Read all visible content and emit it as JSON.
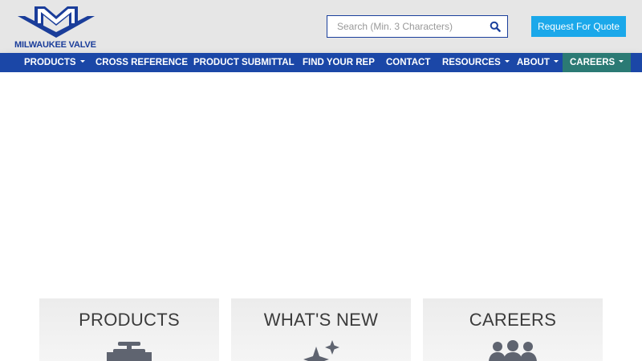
{
  "header": {
    "logo_text": "MILWAUKEE VALVE",
    "search": {
      "placeholder": "Search (Min. 3 Characters)",
      "value": ""
    },
    "quote_button": "Request For Quote"
  },
  "nav": {
    "items": [
      {
        "label": "PRODUCTS",
        "dropdown": true
      },
      {
        "label": "CROSS REFERENCE",
        "dropdown": false
      },
      {
        "label": "PRODUCT SUBMITTAL",
        "dropdown": false
      },
      {
        "label": "FIND YOUR REP",
        "dropdown": false
      },
      {
        "label": "CONTACT",
        "dropdown": false
      },
      {
        "label": "RESOURCES",
        "dropdown": true
      },
      {
        "label": "ABOUT",
        "dropdown": true
      },
      {
        "label": "CAREERS",
        "dropdown": true,
        "active": true
      }
    ]
  },
  "cards": [
    {
      "title": "PRODUCTS",
      "icon": "valve-icon"
    },
    {
      "title": "WHAT'S NEW",
      "icon": "sparkle-icon"
    },
    {
      "title": "CAREERS",
      "icon": "people-icon"
    }
  ],
  "colors": {
    "header_bg": "#e6e6e6",
    "nav_bg": "#1b47a7",
    "nav_active_bg": "#2b7a74",
    "brand_blue": "#1a3d9a",
    "quote_button_bg": "#1ba8ea",
    "card_bg": "#efefef",
    "card_icon": "#5f6470"
  }
}
